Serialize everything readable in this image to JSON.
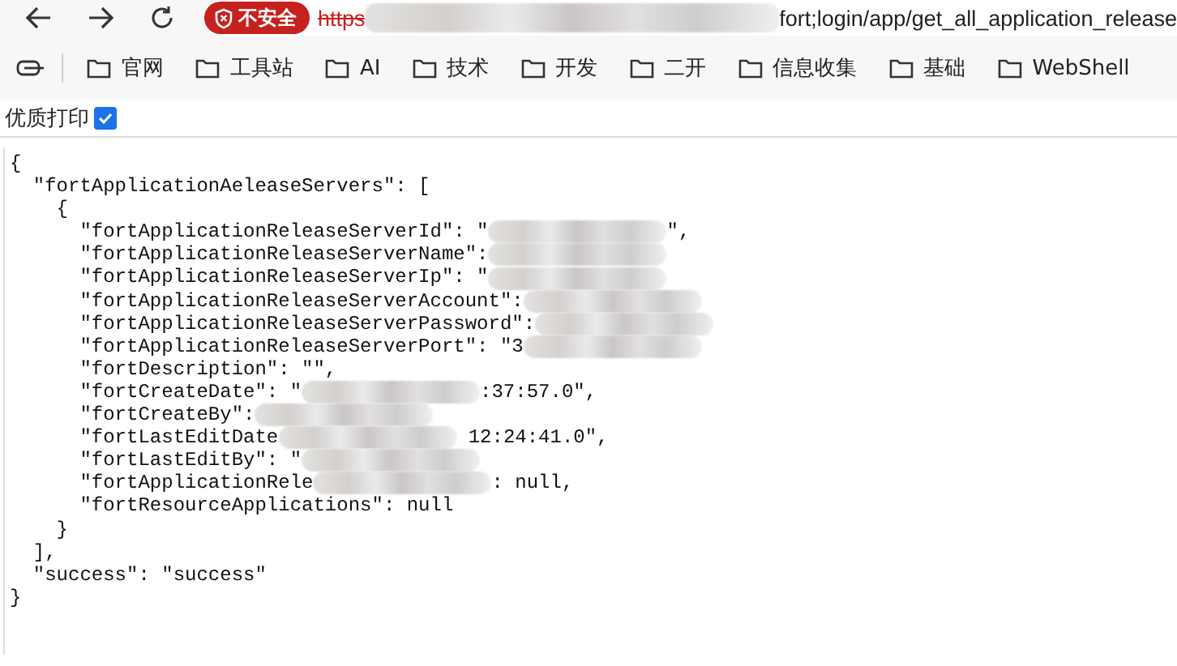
{
  "nav": {
    "security_badge": "不安全",
    "url_scheme": "https",
    "url_redacted": true,
    "url_path": "fort;login/app/get_all_application_release"
  },
  "bookmarks": [
    {
      "label": "官网"
    },
    {
      "label": "工具站"
    },
    {
      "label": "AI"
    },
    {
      "label": "技术"
    },
    {
      "label": "开发"
    },
    {
      "label": "二开"
    },
    {
      "label": "信息收集"
    },
    {
      "label": "基础"
    },
    {
      "label": "WebShell"
    }
  ],
  "print_option": {
    "label": "优质打印",
    "checked": true
  },
  "json_lines": [
    {
      "text": "{"
    },
    {
      "text": "  \"fortApplicationAeleaseServers\": ["
    },
    {
      "text": "    {"
    },
    {
      "text": "      \"fortApplicationReleaseServerId\": \"",
      "redacted": true,
      "tail": "\","
    },
    {
      "text": "      \"fortApplicationReleaseServerName\":",
      "redacted": true
    },
    {
      "text": "      \"fortApplicationReleaseServerIp\": \"",
      "redacted": true
    },
    {
      "text": "      \"fortApplicationReleaseServerAccount\":",
      "redacted": true
    },
    {
      "text": "      \"fortApplicationReleaseServerPassword\":",
      "redacted": true
    },
    {
      "text": "      \"fortApplicationReleaseServerPort\": \"3",
      "redacted": true
    },
    {
      "text": "      \"fortDescription\": \"\","
    },
    {
      "text": "      \"fortCreateDate\": \"",
      "redacted": true,
      "tail": ":37:57.0\","
    },
    {
      "text": "      \"fortCreateBy\":",
      "redacted": true
    },
    {
      "text": "      \"fortLastEditDate",
      "redacted": true,
      "tail": " 12:24:41.0\","
    },
    {
      "text": "      \"fortLastEditBy\": \"",
      "redacted": true
    },
    {
      "text": "      \"fortApplicationRele",
      "redacted": true,
      "tail": ": null,"
    },
    {
      "text": "      \"fortResourceApplications\": null"
    },
    {
      "text": "    }"
    },
    {
      "text": "  ],"
    },
    {
      "text": "  \"success\": \"success\""
    },
    {
      "text": "}"
    }
  ]
}
